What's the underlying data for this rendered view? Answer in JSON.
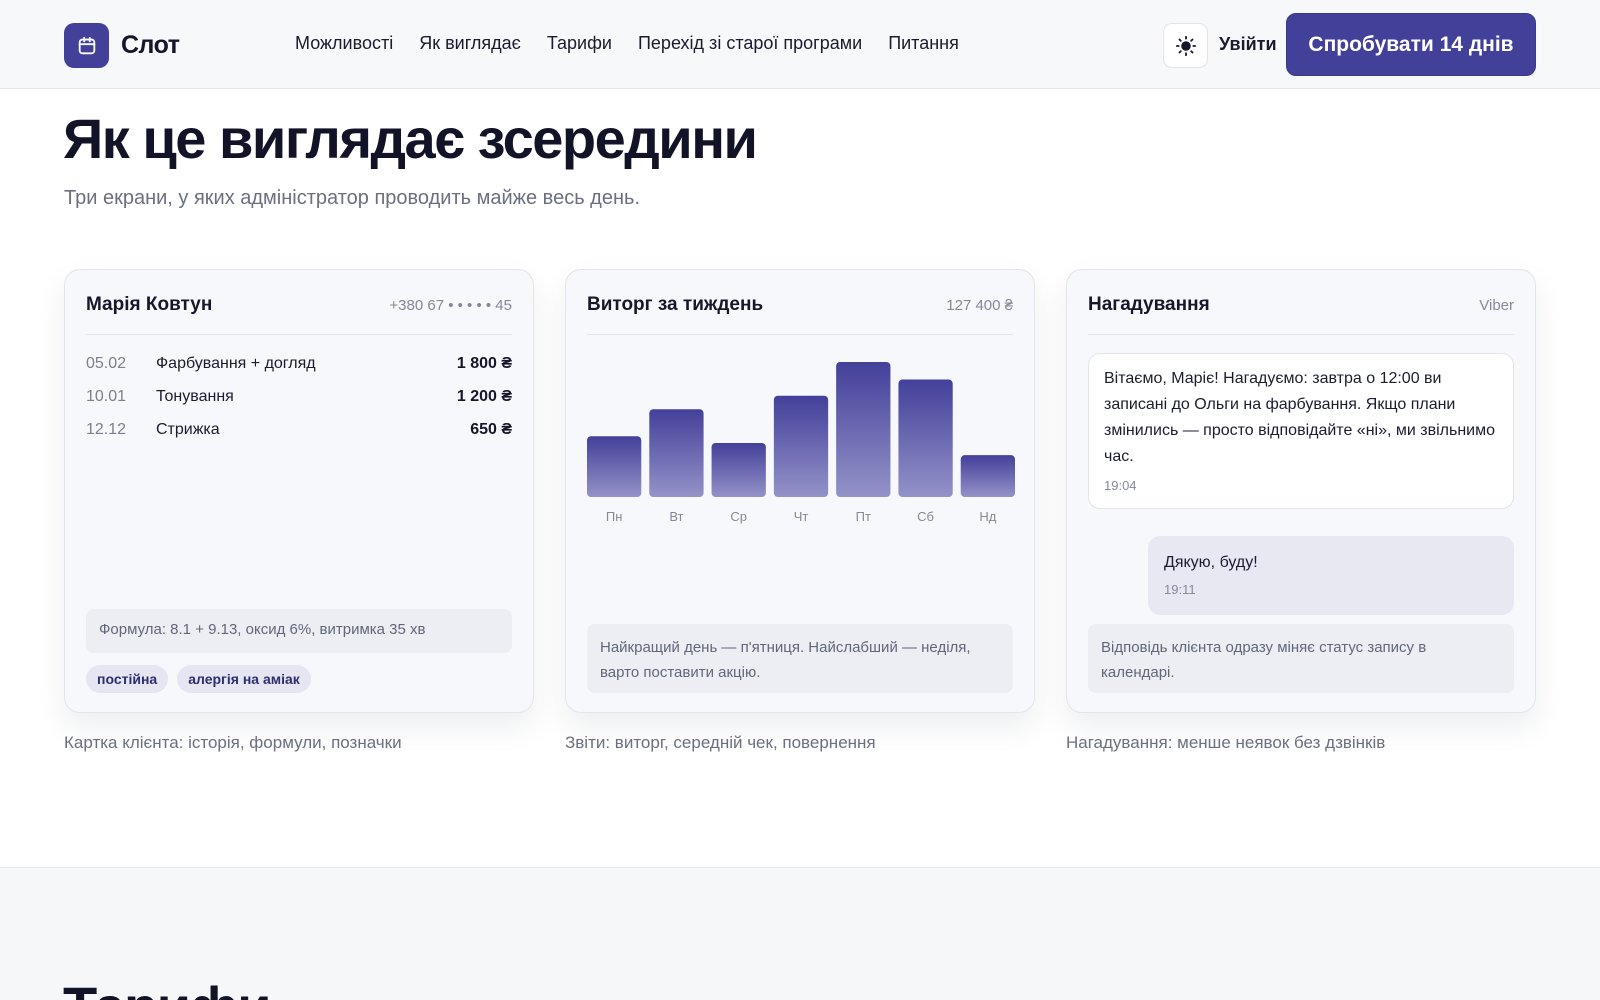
{
  "header": {
    "logo_text": "Слот",
    "nav": [
      "Можливості",
      "Як виглядає",
      "Тарифи",
      "Перехід зі старої програми",
      "Питання"
    ],
    "login": "Увійти",
    "cta": "Спробувати 14 днів"
  },
  "section": {
    "title": "Як це виглядає зсередини",
    "subtitle": "Три екрани, у яких адміністратор проводить майже весь день."
  },
  "client_card": {
    "name": "Марія Ковтун",
    "phone": "+380 67 • • •  • • 45",
    "visits": [
      {
        "date": "05.02",
        "service": "Фарбування + догляд",
        "price": "1 800 ₴"
      },
      {
        "date": "10.01",
        "service": "Тонування",
        "price": "1 200 ₴"
      },
      {
        "date": "12.12",
        "service": "Стрижка",
        "price": "650 ₴"
      }
    ],
    "formula": "Формула: 8.1 + 9.13, оксид 6%, витримка 35 хв",
    "tags": [
      "постійна",
      "алергія на аміак"
    ],
    "caption": "Картка клієнта: історія, формули, позначки"
  },
  "revenue_card": {
    "title": "Виторг за тиждень",
    "total": "127 400 ₴",
    "note": "Найкращий день — п'ятниця. Найслабший — неділя, варто поставити акцію.",
    "caption": "Звіти: виторг, середній чек, повернення"
  },
  "chart_data": {
    "type": "bar",
    "title": "Виторг за тиждень",
    "categories": [
      "Пн",
      "Вт",
      "Ср",
      "Чт",
      "Пт",
      "Сб",
      "Нд"
    ],
    "values": [
      45,
      65,
      40,
      75,
      100,
      87,
      31
    ],
    "ylim": [
      0,
      100
    ],
    "grid": false,
    "bar_color_top": "#43409a",
    "bar_color_bottom": "#9492c8"
  },
  "reminder_card": {
    "title": "Нагадування",
    "channel": "Viber",
    "incoming_text": "Вітаємо, Маріє! Нагадуємо: завтра о 12:00 ви записані до Ольги на фарбування. Якщо плани змінились — просто відповідайте «ні», ми звільнимо час.",
    "incoming_time": "19:04",
    "reply_text": "Дякую, буду!",
    "reply_time": "19:11",
    "note": "Відповідь клієнта одразу міняє статус запису в календарі.",
    "caption": "Нагадування: менше неявок без дзвінків"
  },
  "next_section": {
    "title": "Тарифи"
  },
  "colors": {
    "accent": "#43409a",
    "text": "#16172b",
    "muted": "#6b6f80"
  }
}
